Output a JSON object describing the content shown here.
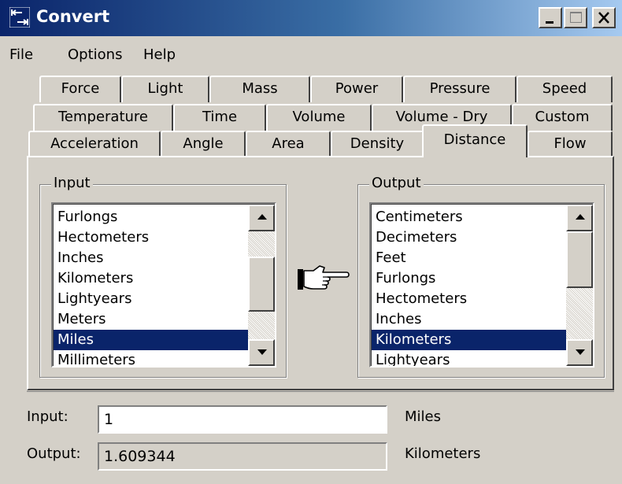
{
  "window": {
    "title": "Convert",
    "colors": {
      "titlebar_start": "#0a246a",
      "titlebar_end": "#a6caf0",
      "face": "#d4d0c8",
      "selection": "#0a246a"
    }
  },
  "menu": [
    "File",
    "Options",
    "Help"
  ],
  "tabs": {
    "row1": [
      "Force",
      "Light",
      "Mass",
      "Power",
      "Pressure",
      "Speed"
    ],
    "row2": [
      "Temperature",
      "Time",
      "Volume",
      "Volume - Dry",
      "Custom"
    ],
    "row3": [
      "Acceleration",
      "Angle",
      "Area",
      "Density",
      "Distance",
      "Flow"
    ],
    "active": "Distance"
  },
  "input_group": {
    "label": "Input",
    "items": [
      "Furlongs",
      "Hectometers",
      "Inches",
      "Kilometers",
      "Lightyears",
      "Meters",
      "Miles",
      "Millimeters"
    ],
    "selected": "Miles"
  },
  "output_group": {
    "label": "Output",
    "items": [
      "Centimeters",
      "Decimeters",
      "Feet",
      "Furlongs",
      "Hectometers",
      "Inches",
      "Kilometers",
      "Lightyears"
    ],
    "selected": "Kilometers"
  },
  "convert_icon": "pointing-hand-icon",
  "fields": {
    "input_label": "Input:",
    "input_value": "1",
    "input_unit": "Miles",
    "output_label": "Output:",
    "output_value": "1.609344",
    "output_unit": "Kilometers"
  }
}
